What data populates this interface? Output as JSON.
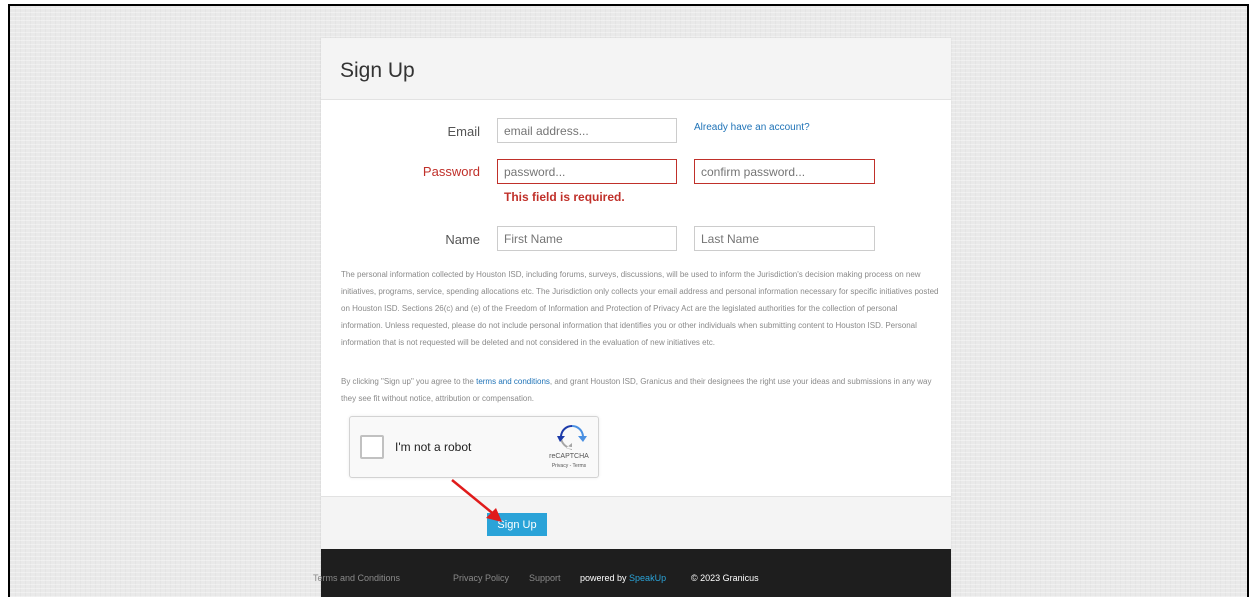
{
  "page": {
    "title": "Sign Up"
  },
  "form": {
    "email": {
      "label": "Email",
      "placeholder": "email address...",
      "value": ""
    },
    "already_account_link": "Already have an account?",
    "password": {
      "label": "Password",
      "placeholder": "password...",
      "value": ""
    },
    "confirm_password": {
      "placeholder": "confirm password...",
      "value": ""
    },
    "password_error": "This field is required.",
    "name": {
      "label": "Name"
    },
    "first_name": {
      "placeholder": "First Name",
      "value": ""
    },
    "last_name": {
      "placeholder": "Last Name",
      "value": ""
    }
  },
  "disclaimer": {
    "privacy_text": "The personal information collected by Houston ISD, including forums, surveys, discussions, will be used to inform the Jurisdiction's decision making process on new initiatives, programs, service, spending allocations etc. The Jurisdiction only collects your email address and personal information necessary for specific initiatives posted on Houston ISD. Sections 26(c) and (e) of the Freedom of Information and Protection of Privacy Act are the legislated authorities for the collection of personal information. Unless requested, please do not include personal information that identifies you or other individuals when submitting content to Houston ISD. Personal information that is not requested will be deleted and not considered in the evaluation of new initiatives etc.",
    "agree_before": "By clicking \"Sign up\" you agree to the ",
    "agree_link": "terms and conditions",
    "agree_after": ", and grant Houston ISD, Granicus and their designees the right use your ideas and submissions in any way they see fit without notice, attribution or compensation."
  },
  "captcha": {
    "label": "I'm not a robot",
    "brand": "reCAPTCHA",
    "links": "Privacy - Terms"
  },
  "actions": {
    "signup_label": "Sign Up"
  },
  "footer": {
    "terms": "Terms and Conditions",
    "privacy": "Privacy Policy",
    "support": "Support",
    "powered_by": "powered by",
    "powered_brand": "SpeakUp",
    "copyright": "© 2023 Granicus"
  },
  "colors": {
    "accent": "#2aa3d8",
    "error": "#c0302a",
    "link": "#1f73b7",
    "footer_bg": "#1e1e1e",
    "annotation_arrow": "#e01b1b"
  },
  "icons": {
    "captcha_logo": "recaptcha-icon",
    "annotation": "red-arrow-icon"
  }
}
